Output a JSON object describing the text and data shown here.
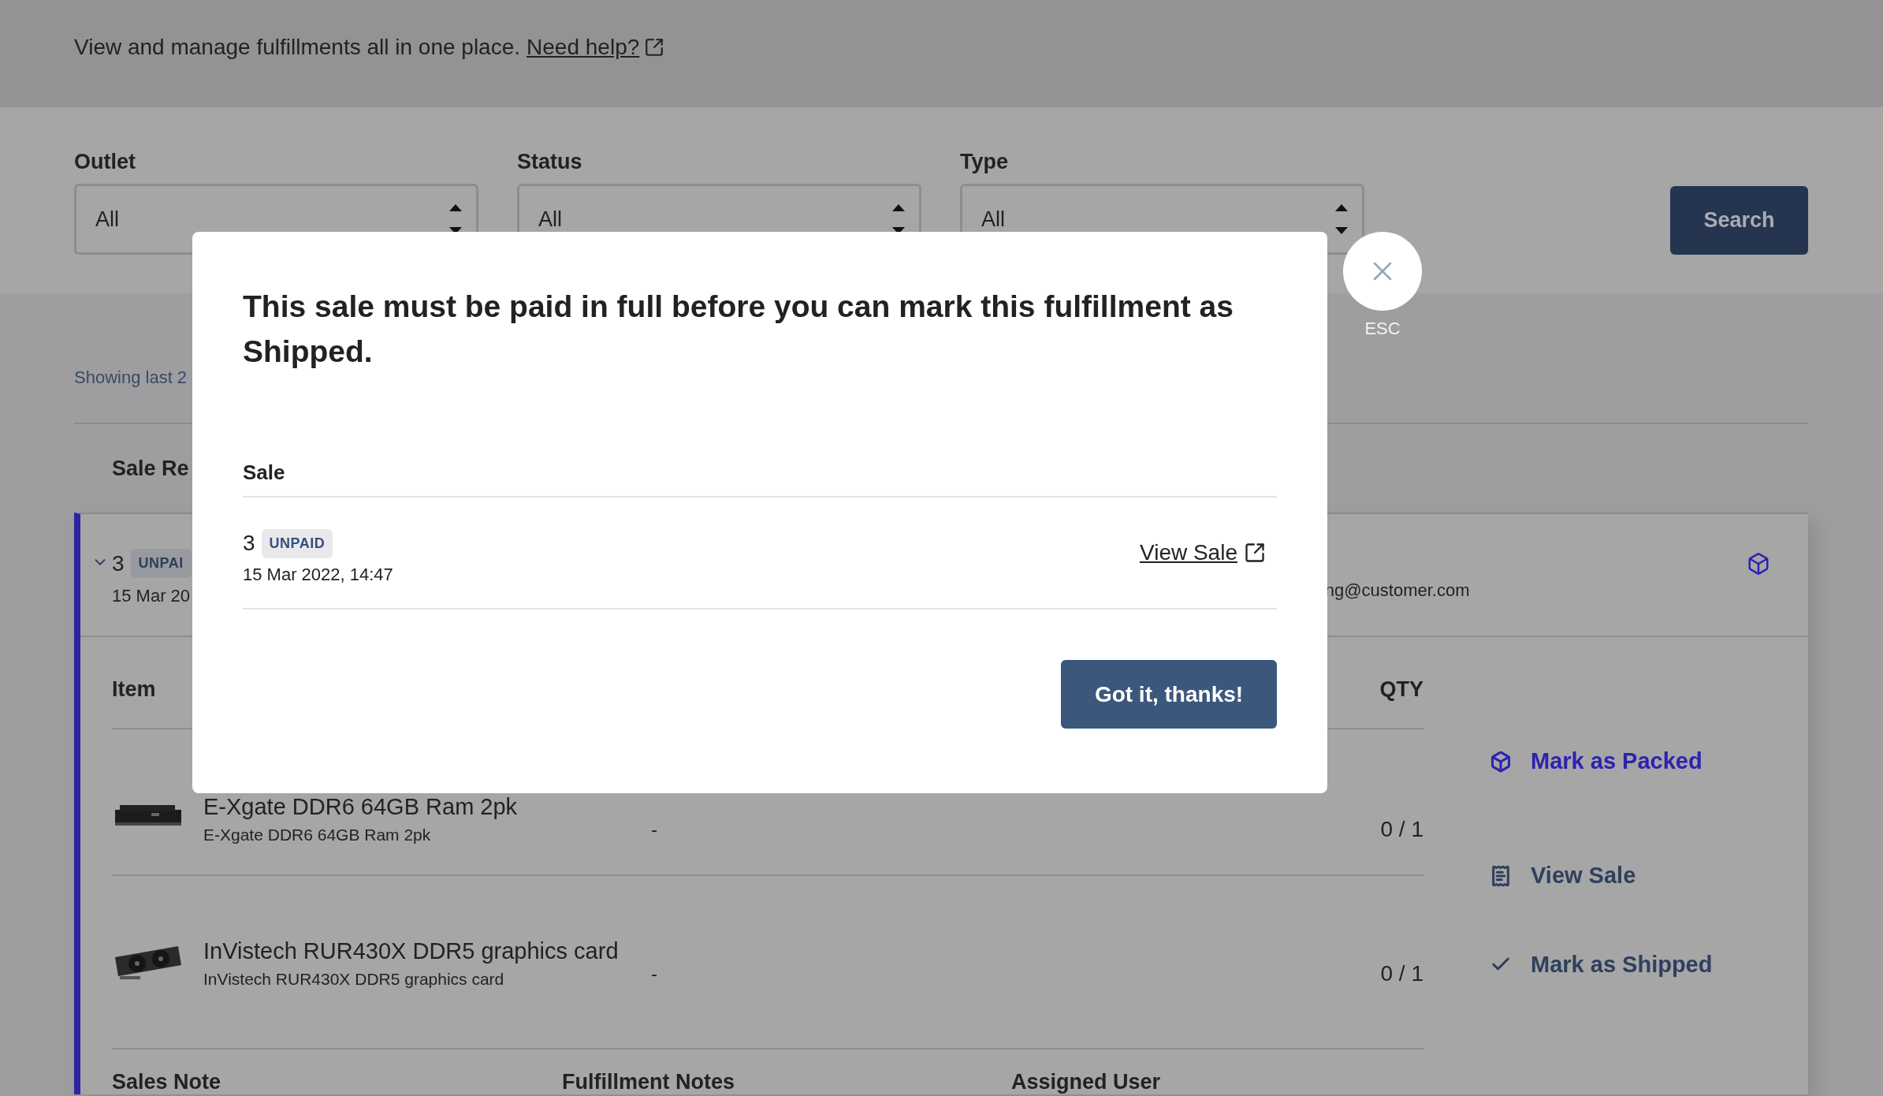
{
  "header": {
    "intro": "View and manage fulfillments all in one place.",
    "help_link": "Need help?"
  },
  "filters": [
    {
      "label": "Outlet",
      "value": "All"
    },
    {
      "label": "Status",
      "value": "All"
    },
    {
      "label": "Type",
      "value": "All"
    }
  ],
  "search_button": "Search",
  "showing": "Showing last 2",
  "table_header": "Sale Re",
  "fulfillment": {
    "expanded": true,
    "number": "3",
    "badge": "UNPAI",
    "date": "15 Mar 20",
    "email": "ng@customer.com",
    "items_header": {
      "item": "Item",
      "qty": "QTY"
    },
    "items": [
      {
        "title": "E-Xgate DDR6 64GB Ram 2pk",
        "subtitle": "E-Xgate DDR6 64GB Ram 2pk",
        "column_3": "-",
        "qty": "0 / 1",
        "kind": "ram"
      },
      {
        "title": "InVistech RUR430X DDR5 graphics card",
        "subtitle": "InVistech RUR430X DDR5 graphics card",
        "column_3": "-",
        "qty": "0 / 1",
        "kind": "gpu"
      }
    ],
    "actions": [
      {
        "kind": "packed",
        "label": "Mark as Packed"
      },
      {
        "kind": "view",
        "label": "View Sale"
      },
      {
        "kind": "shipped",
        "label": "Mark as Shipped"
      }
    ],
    "notes": [
      "Sales Note",
      "Fulfillment Notes",
      "Assigned User"
    ]
  },
  "modal": {
    "title": "This sale must be paid in full before you can mark this fulfillment as Shipped.",
    "column": "Sale",
    "sale": {
      "number": "3",
      "badge": "UNPAID",
      "date": "15 Mar 2022, 14:47",
      "link": "View Sale"
    },
    "button": "Got it, thanks!",
    "close_hint": "ESC"
  }
}
